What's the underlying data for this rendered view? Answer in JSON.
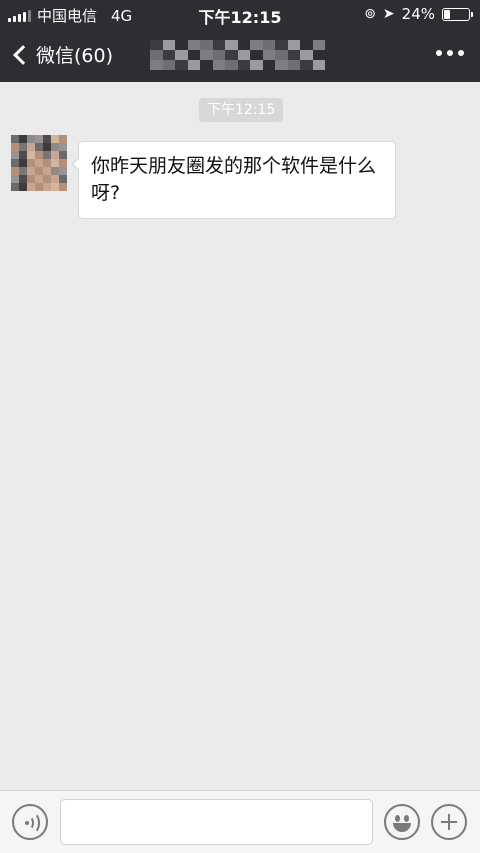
{
  "status_bar": {
    "carrier": "中国电信",
    "network": "4G",
    "time": "下午12:15",
    "battery_percent": "24%",
    "battery_level": 0.24
  },
  "nav": {
    "back_label": "微信(60)",
    "title_obscured": true
  },
  "chat": {
    "timestamp": "下午12:15",
    "messages": [
      {
        "sender": "contact",
        "text": "你昨天朋友圈发的那个软件是什么呀?"
      }
    ]
  },
  "input": {
    "value": "",
    "icons": [
      "voice-icon",
      "emoji-icon",
      "plus-icon"
    ]
  },
  "colors": {
    "nav_bg": "#2e2e32",
    "chat_bg": "#ebebeb",
    "bubble_bg": "#ffffff",
    "timestamp_bg": "#d7d7d7"
  }
}
